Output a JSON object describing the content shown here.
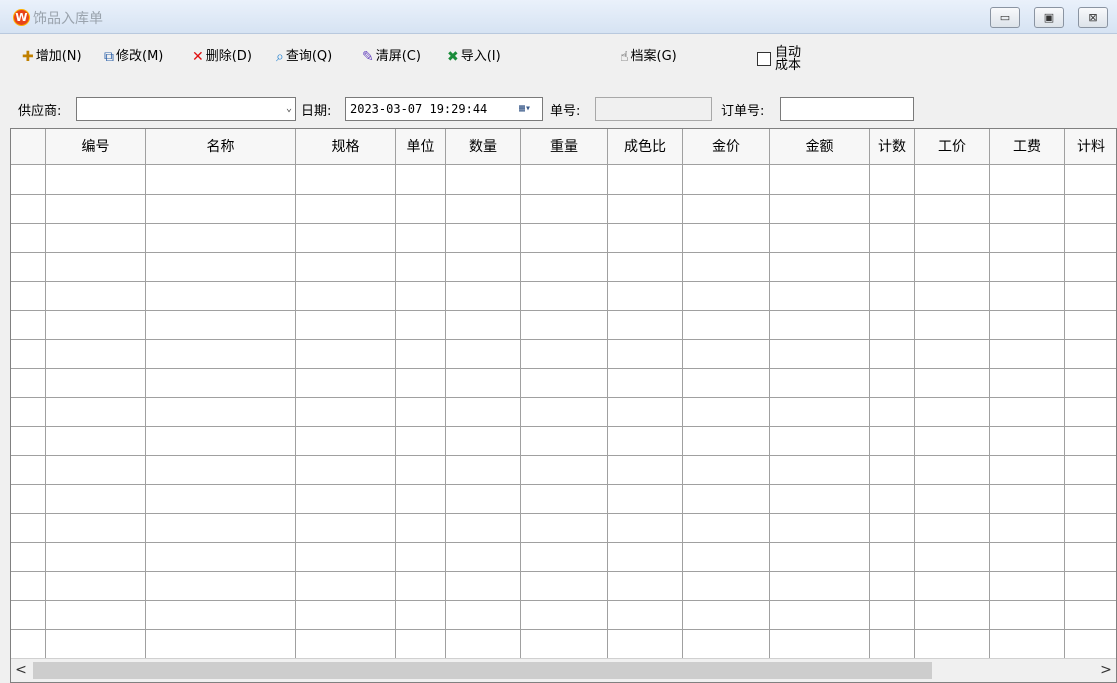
{
  "window": {
    "title": "饰品入库单",
    "app_icon_letter": "W",
    "minimize": "▭",
    "maximize": "▣",
    "close": "⊠"
  },
  "toolbar": {
    "add": {
      "icon": "✚",
      "label": "增加(N)"
    },
    "edit": {
      "icon": "⧉",
      "label": "修改(M)"
    },
    "delete": {
      "icon": "✕",
      "label": "删除(D)"
    },
    "query": {
      "icon": "⌕",
      "label": "查询(Q)"
    },
    "clear": {
      "icon": "✎",
      "label": "清屏(C)"
    },
    "import": {
      "icon": "✖",
      "label": "导入(I)"
    },
    "archive": {
      "icon": "☝",
      "label": "档案(G)"
    },
    "auto_cost_label": "自动成本",
    "auto_cost_checked": false
  },
  "filter": {
    "supplier_label": "供应商:",
    "supplier_value": "",
    "date_label": "日期:",
    "date_value": "2023-03-07 19:29:44",
    "bill_no_label": "单号:",
    "bill_no_value": "",
    "order_no_label": "订单号:",
    "order_no_value": ""
  },
  "grid": {
    "columns": [
      "",
      "编号",
      "名称",
      "规格",
      "单位",
      "数量",
      "重量",
      "成色比",
      "金价",
      "金额",
      "计数",
      "工价",
      "工费",
      "计料"
    ]
  },
  "scrollbar": {
    "left": "<",
    "right": ">"
  },
  "colors": {
    "accent": "#e8441a",
    "grid_line": "#a0a0a0"
  }
}
